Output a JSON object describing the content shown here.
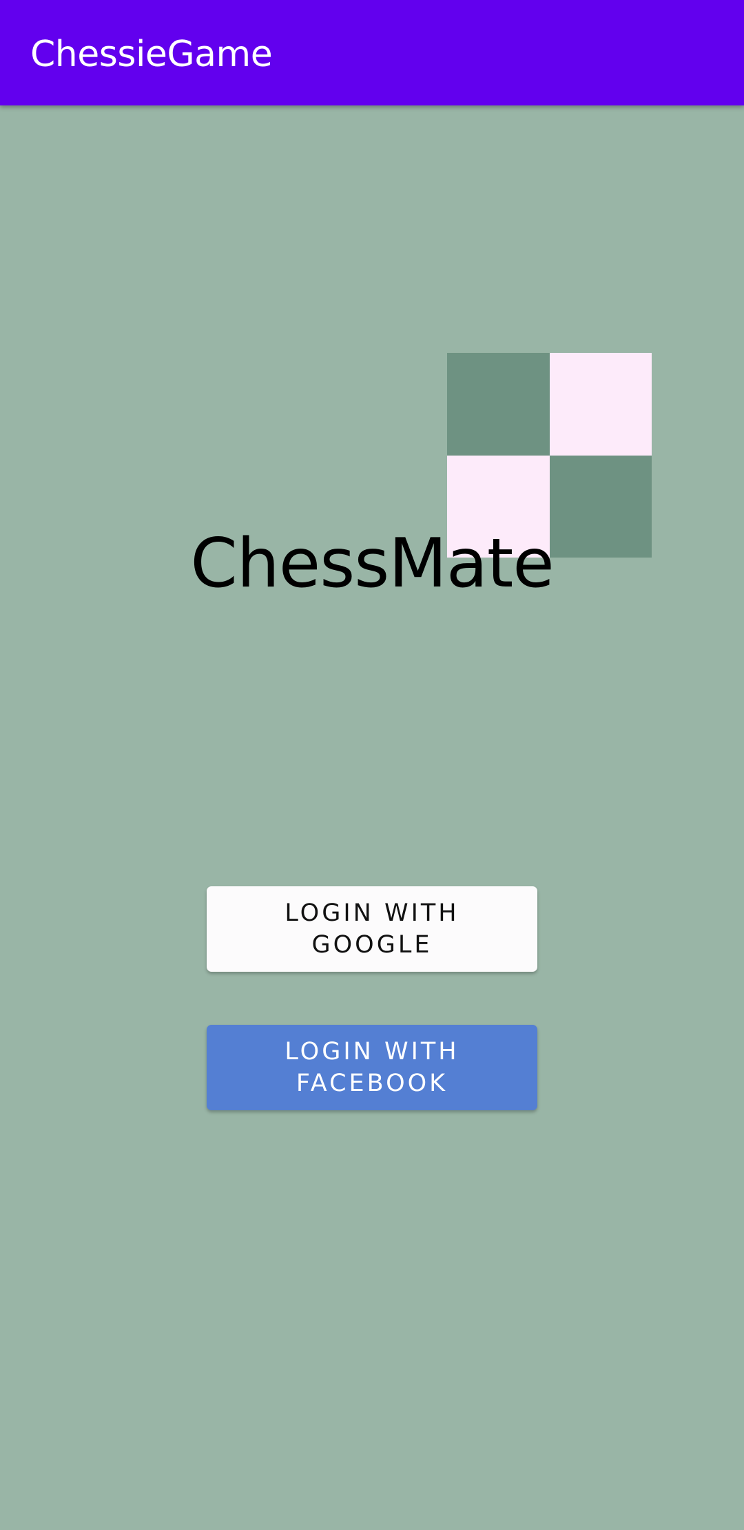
{
  "app_bar": {
    "title": "ChessieGame",
    "color": "#6200ee"
  },
  "screen": {
    "background": "#99b5a6"
  },
  "logo": {
    "icon": "chessboard-icon",
    "dark_square": "#6e9282",
    "light_square": "#fdebfa"
  },
  "brand": {
    "title": "ChessMate"
  },
  "buttons": {
    "google": {
      "label": "LOGIN WITH GOOGLE",
      "background": "#fcfbfc"
    },
    "facebook": {
      "label": "LOGIN WITH FACEBOOK",
      "background": "#547fd3"
    }
  }
}
